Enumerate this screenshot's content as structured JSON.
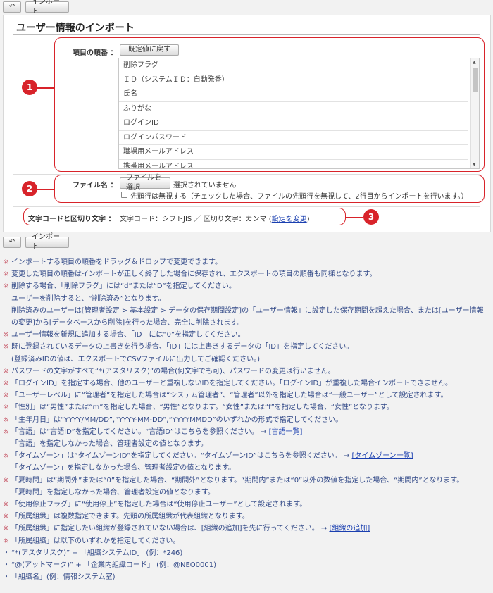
{
  "toolbar": {
    "back_glyph": "↶",
    "import_label": "インポート"
  },
  "page_title": "ユーザー情報のインポート",
  "order": {
    "label": "項目の順番 ：",
    "reset_button": "既定値に戻す",
    "items": [
      "削除フラグ",
      "ＩＤ（システムＩＤ：自動発番）",
      "氏名",
      "ふりがな",
      "ログインID",
      "ログインパスワード",
      "職場用メールアドレス",
      "携帯用メールアドレス"
    ]
  },
  "file": {
    "label": "ファイル名 ：",
    "choose_button": "ファイルを選択",
    "no_file_text": "選択されていません",
    "skip_first_row_label": "先頭行は無視する（チェックした場合、ファイルの先頭行を無視して、2行目からインポートを行います。）"
  },
  "charset": {
    "label": "文字コードと区切り文字 ：",
    "value_text": "文字コード：シフトJIS ／ 区切り文字：カンマ (",
    "change_link": "設定を変更",
    "close_paren": ")"
  },
  "badges": [
    "1",
    "2",
    "3"
  ],
  "notes": {
    "mark": "※",
    "bullet": "・",
    "n1": "インポートする項目の順番をドラッグ＆ドロップで変更できます。",
    "n2": "変更した項目の順番はインポートが正しく終了した場合に保存され、エクスポートの項目の順番も同様となります。",
    "n3": "削除する場合、「削除フラグ」には“d”または“D”を指定してください。",
    "n3a": "ユーザーを削除すると、“削除済み”となります。",
    "n3b": "削除済みのユーザーは[管理者設定 > 基本設定 > データの保存期間設定]の「ユーザー情報」に設定した保存期間を超えた場合、または[ユーザー情報",
    "n3c": "の変更]から[データベースから削除]を行った場合、完全に削除されます。",
    "n4": "ユーザー情報を新規に追加する場合、「ID」には“0”を指定してください。",
    "n5": "既に登録されているデータの上書きを行う場合、「ID」には上書きするデータの「ID」を指定してください。",
    "n5a": "(登録済みIDの値は、エクスポートでCSVファイルに出力してご確認ください。)",
    "n6": "パスワードの文字がすべて“*(アスタリスク)”の場合(何文字でも可)、パスワードの変更は行いません。",
    "n7": "「ログインID」を指定する場合、他のユーザーと重複しないIDを指定してください。「ログインID」が重複した場合インポートできません。",
    "n8": "「ユーザーレベル」に“管理者”を指定した場合は“システム管理者”、“管理者”以外を指定した場合は“一般ユーザー”として設定されます。",
    "n9": "「性別」は“男性”または“m”を指定した場合、“男性”となります。“女性”または“f”を指定した場合、“女性”となります。",
    "n10": "「生年月日」は“YYYY/MM/DD”,“YYYY-MM-DD”,“YYYYMMDD”のいずれかの形式で指定してください。",
    "n11": "「言語」は“言語ID”を指定してください。“言語ID”はこちらを参照ください。 → ",
    "n11_link": "[言語一覧]",
    "n11a": "「言語」を指定しなかった場合、管理者設定の値となります。",
    "n12": "「タイムゾーン」は“タイムゾーンID”を指定してください。“タイムゾーンID”はこちらを参照ください。 → ",
    "n12_link": "[タイムゾーン一覧]",
    "n12a": "「タイムゾーン」を指定しなかった場合、管理者設定の値となります。",
    "n13": "「夏時間」は“期間外”または“0”を指定した場合、“期間外”となります。“期間内”または“0”以外の数値を指定した場合、“期間内”となります。",
    "n13a": "「夏時間」を指定しなかった場合、管理者設定の値となります。",
    "n14": "「使用停止フラグ」に“使用停止”を指定した場合は“使用停止ユーザー”として設定されます。",
    "n15": "「所属組織」は複数指定できます。先頭の所属組織が代表組織となります。",
    "n16": "「所属組織」に指定したい組織が登録されていない場合は、[組織の追加]を先に行ってください。 → ",
    "n16_link": "[組織の追加]",
    "n17": "「所属組織」は以下のいずれかを指定してください。",
    "b1": "“*(アスタリスク)” + 「組織システムID」 (例：*246)",
    "b2": "“@(アットマーク)” + 「企業内組織コード」 (例：@NEO0001)",
    "b3": "「組織名」(例：情報システム室)"
  }
}
